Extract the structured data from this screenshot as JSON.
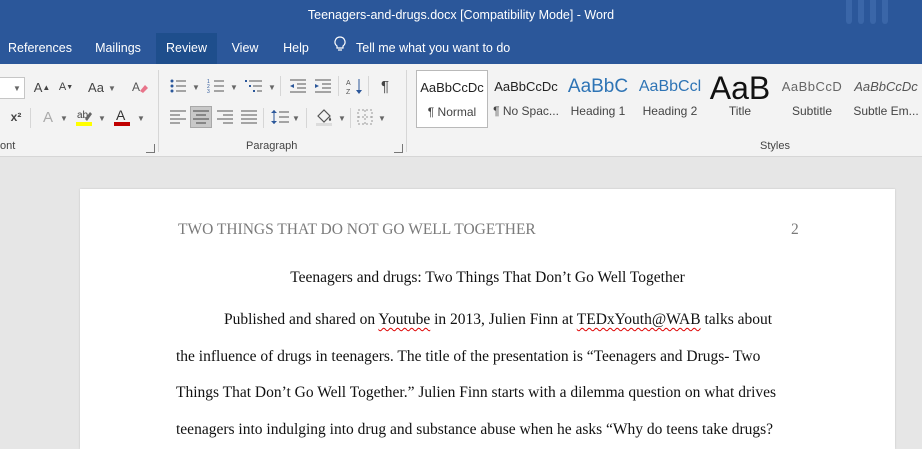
{
  "window": {
    "title": "Teenagers-and-drugs.docx [Compatibility Mode]  -  Word"
  },
  "menu": {
    "tabs": [
      {
        "label": "References"
      },
      {
        "label": "Mailings"
      },
      {
        "label": "Review"
      },
      {
        "label": "View"
      },
      {
        "label": "Help"
      }
    ],
    "active_tab": "Review",
    "tell_me": "Tell me what you want to do"
  },
  "ribbon": {
    "font_group_label": "ont",
    "paragraph_group_label": "Paragraph",
    "styles_group_label": "Styles",
    "font_size_grow": "A",
    "font_size_shrink": "A",
    "change_case": "Aa",
    "superscript": "x²",
    "text_effects": "A",
    "font_color_letter": "A",
    "font_color": "#c00000",
    "highlight_color": "#ffff00",
    "styles": [
      {
        "preview": "AaBbCcDc",
        "name": "¶ Normal"
      },
      {
        "preview": "AaBbCcDc",
        "name": "¶ No Spac..."
      },
      {
        "preview": "AaBbC",
        "name": "Heading 1"
      },
      {
        "preview": "AaBbCcl",
        "name": "Heading 2"
      },
      {
        "preview": "AaB",
        "name": "Title"
      },
      {
        "preview": "AaBbCcD",
        "name": "Subtitle"
      },
      {
        "preview": "AaBbCcDc",
        "name": "Subtle Em..."
      }
    ]
  },
  "document": {
    "running_head": "TWO THINGS THAT DO NOT GO WELL TOGETHER",
    "page_number": "2",
    "title": "Teenagers and drugs: Two Things That Don’t Go Well Together",
    "lines": [
      {
        "pre": "Published and shared on ",
        "err1": "Youtube",
        "mid": " in 2013, Julien Finn at ",
        "err2": "TEDxYouth@WAB",
        "post": " talks about"
      },
      {
        "text": "the influence of drugs in teenagers. The title of the presentation is “Teenagers and Drugs- Two"
      },
      {
        "text": "Things That Don’t Go Well Together.” Julien Finn starts with a dilemma question on what drives"
      },
      {
        "text": "teenagers into indulging into drug and substance abuse when he asks “Why do teens take drugs?"
      }
    ]
  }
}
